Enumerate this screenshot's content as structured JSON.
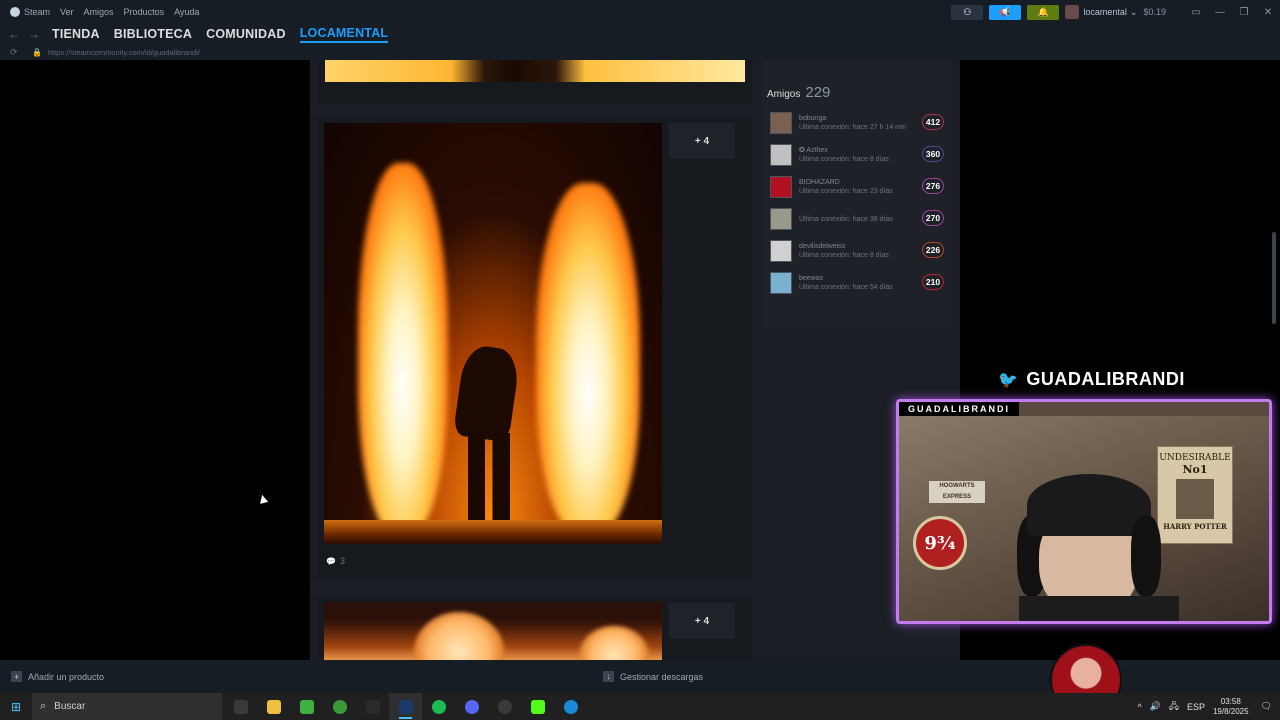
{
  "menubar": {
    "app_name": "Steam",
    "items": [
      "Ver",
      "Amigos",
      "Productos",
      "Ayuda"
    ],
    "account_name": "locamental",
    "wallet": "$0.19"
  },
  "nav": {
    "links": [
      "TIENDA",
      "BIBLIOTECA",
      "COMUNIDAD",
      "LOCAMENTAL"
    ],
    "active": "LOCAMENTAL",
    "url": "https://steamcommunity.com/id/guadalibrandi/"
  },
  "feed": {
    "more_label": "+ 4",
    "more_label_2": "+ 4",
    "comment_count": "3"
  },
  "friends": {
    "title": "Amigos",
    "count": "229",
    "list": [
      {
        "name": "bobunga",
        "status": "Última conexión: hace 27 h 14 min",
        "level": "412",
        "level_color": "#b03050",
        "avatar_color": "#7a6050"
      },
      {
        "name": "✪ Azthex",
        "status": "Última conexión: hace 8 días",
        "level": "360",
        "level_color": "#4a4a90",
        "avatar_color": "#c0c0c0"
      },
      {
        "name": "BIOHAZARD",
        "status": "Última conexión: hace 23 días",
        "level": "276",
        "level_color": "#a040a0",
        "avatar_color": "#b01020"
      },
      {
        "name": "",
        "status": "Última conexión: hace 38 días",
        "level": "270",
        "level_color": "#a040a0",
        "avatar_color": "#9a9a8a"
      },
      {
        "name": "devilisdelweiss",
        "status": "Última conexión: hace 8 días",
        "level": "226",
        "level_color": "#c04020",
        "avatar_color": "#d0d0d0"
      },
      {
        "name": "beewax",
        "status": "Última conexión: hace 54 días",
        "level": "210",
        "level_color": "#c02030",
        "avatar_color": "#7ab0d0"
      }
    ]
  },
  "overlay": {
    "twitter_handle": "GUADALIBRANDI",
    "cam_label": "GUADALIBRANDI",
    "poster_line1": "UNDESIRABLE",
    "poster_line2": "No1",
    "poster_line3": "HARRY POTTER",
    "platform_label": "9¾",
    "hogwarts_label": "HOGWARTS EXPRESS"
  },
  "steam_bottom": {
    "add_product": "Añadir un producto",
    "manage_downloads": "Gestionar descargas"
  },
  "taskbar": {
    "search_placeholder": "Buscar",
    "lang": "ESP",
    "time": "03:58",
    "date": "19/8/2025",
    "apps": [
      {
        "name": "mic-icon",
        "color": "#3a3a3a"
      },
      {
        "name": "file-explorer-icon",
        "color": "#f0c040"
      },
      {
        "name": "app-green-icon",
        "color": "#40b040"
      },
      {
        "name": "xbox-icon",
        "color": "#3a9a3a"
      },
      {
        "name": "epic-games-icon",
        "color": "#2a2a2a"
      },
      {
        "name": "steam-icon",
        "color": "#1a3a6a"
      },
      {
        "name": "spotify-icon",
        "color": "#1db954"
      },
      {
        "name": "discord-icon",
        "color": "#5865f2"
      },
      {
        "name": "obs-icon",
        "color": "#3a3a3a"
      },
      {
        "name": "kick-icon",
        "color": "#53fc18"
      },
      {
        "name": "edge-icon",
        "color": "#1a8ad8"
      }
    ]
  }
}
